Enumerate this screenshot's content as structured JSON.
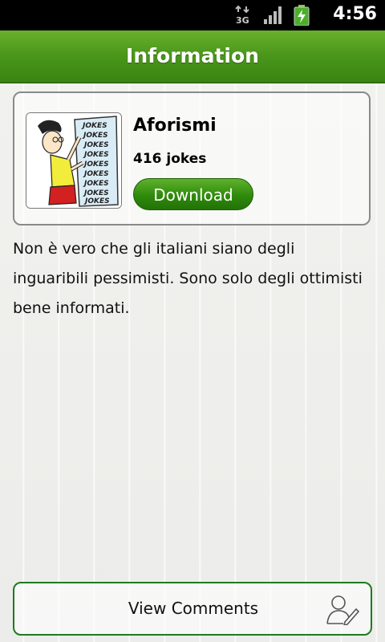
{
  "status_bar": {
    "time": "4:56",
    "network": "3G",
    "icons": [
      "data-3g-icon",
      "signal-icon",
      "battery-charging-icon"
    ]
  },
  "header": {
    "title": "Information"
  },
  "card": {
    "name": "Aforismi",
    "count": "416 jokes",
    "download_label": "Download",
    "thumbnail_text": "JOKES"
  },
  "description": "Non è vero che gli italiani siano degli inguaribili pessimisti. Sono solo degli ottimisti bene informati.",
  "footer": {
    "comments_label": "View Comments",
    "comments_icon": "edit-user-icon"
  },
  "colors": {
    "accent_green": "#3a8512",
    "button_green": "#2f8a0c"
  }
}
